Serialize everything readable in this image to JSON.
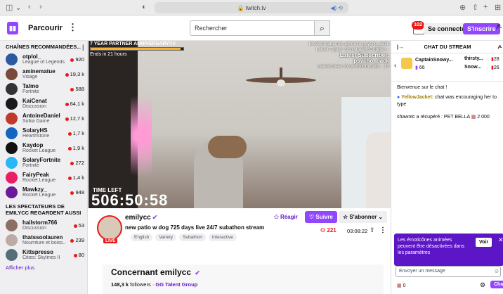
{
  "browser": {
    "url": "twitch.tv"
  },
  "topnav": {
    "browse_label": "Parcourir",
    "search_placeholder": "Rechercher",
    "notif_count": "102",
    "login_label": "Se connecter",
    "signup_label": "S'inscrire"
  },
  "sidebar": {
    "recommended_header": "CHAÎNES RECOMMANDÉES",
    "channels": [
      {
        "name": "otplol_",
        "game": "League of Legends",
        "viewers": "920",
        "color": "#2c5aa0"
      },
      {
        "name": "aminematue",
        "game": "Visage",
        "viewers": "19,3 k",
        "color": "#7a4a3a"
      },
      {
        "name": "Talmo",
        "game": "Fortnite",
        "viewers": "588",
        "color": "#333"
      },
      {
        "name": "KaiCenat",
        "game": "Discussion",
        "viewers": "64,1 k",
        "color": "#1a1a1a"
      },
      {
        "name": "AntoineDaniel",
        "game": "Sulka Game",
        "viewers": "12,7 k",
        "color": "#c0392b"
      },
      {
        "name": "SolaryHS",
        "game": "Hearthstone",
        "viewers": "1,7 k",
        "color": "#1565c0"
      },
      {
        "name": "Kaydop",
        "game": "Rocket League",
        "viewers": "1,9 k",
        "color": "#111"
      },
      {
        "name": "SolaryFortnite",
        "game": "Fortnite",
        "viewers": "272",
        "color": "#29b6f6"
      },
      {
        "name": "FairyPeak",
        "game": "Rocket League",
        "viewers": "1,4 k",
        "color": "#e91e63"
      },
      {
        "name": "Mawkzy_",
        "game": "Rocket League",
        "viewers": "948",
        "color": "#6a1b9a"
      }
    ],
    "viewers_header": "LES SPECTATEURS DE EMILYCC REGARDENT AUSSI",
    "also_watch": [
      {
        "name": "hailstorm766",
        "game": "Discussion",
        "viewers": "53",
        "color": "#8d6e63"
      },
      {
        "name": "thatssoolauren",
        "game": "Nourriture et boiss...",
        "viewers": "239",
        "color": "#bcaaa4"
      },
      {
        "name": "Kittspresso",
        "game": "Cities: Skylines II",
        "viewers": "80",
        "color": "#546e7a"
      }
    ],
    "show_more": "Afficher plus"
  },
  "player": {
    "overlay_title": "7 YEAR PARTNER ANNIVERSARY!!!!",
    "ends_in": "Ends in 21 hours",
    "overlay_right_1": "browithnothumbs gifted to psycho_back",
    "overlay_right_2": "Latest Tipper: SnowballMcGobbles -",
    "overlay_right_3": "Latest Subscriber: psycho_back",
    "overlay_right_4": "Latest cheer: browithnothumbs - 10",
    "time_left_label": "TIME LEFT",
    "timer": "506:50:58",
    "anniversary_progress": 0.97
  },
  "stream": {
    "channel_name": "emilycc",
    "title": "new patio w dog 725 days live 24/7 subathon stream",
    "tags": [
      "English",
      "Variety",
      "Subathon",
      "Interactive"
    ],
    "live_label": "LIVE",
    "react_label": "Réagir",
    "follow_label": "Suivre",
    "subscribe_label": "S'abonner",
    "viewers": "221",
    "uptime": "03:08:22"
  },
  "about": {
    "title": "Concernant emilycc",
    "followers": "148,3 k",
    "followers_label": "followers",
    "team": "GG Talent Group"
  },
  "chat": {
    "header": "CHAT DU STREAM",
    "gift1_name": "CaptainSnowy...",
    "gift1_count": "66",
    "gift2_name": "thirsty...",
    "gift2_count": "28",
    "gift3_name": "Snow...",
    "gift3_count": "26",
    "welcome": "Bienvenue sur le chat !",
    "msg_user": "YellowJacket:",
    "msg_text": "chat was encouraging her to type",
    "redeem": "shawntc a récupéré : PET BELLA",
    "redeem_cost": "2 000",
    "banner_text": "Les émoticônes animées peuvent être désactivées dans les paramètres",
    "banner_button": "Voir",
    "input_placeholder": "Envoyer un message",
    "points": "0",
    "chat_button": "Chat"
  }
}
